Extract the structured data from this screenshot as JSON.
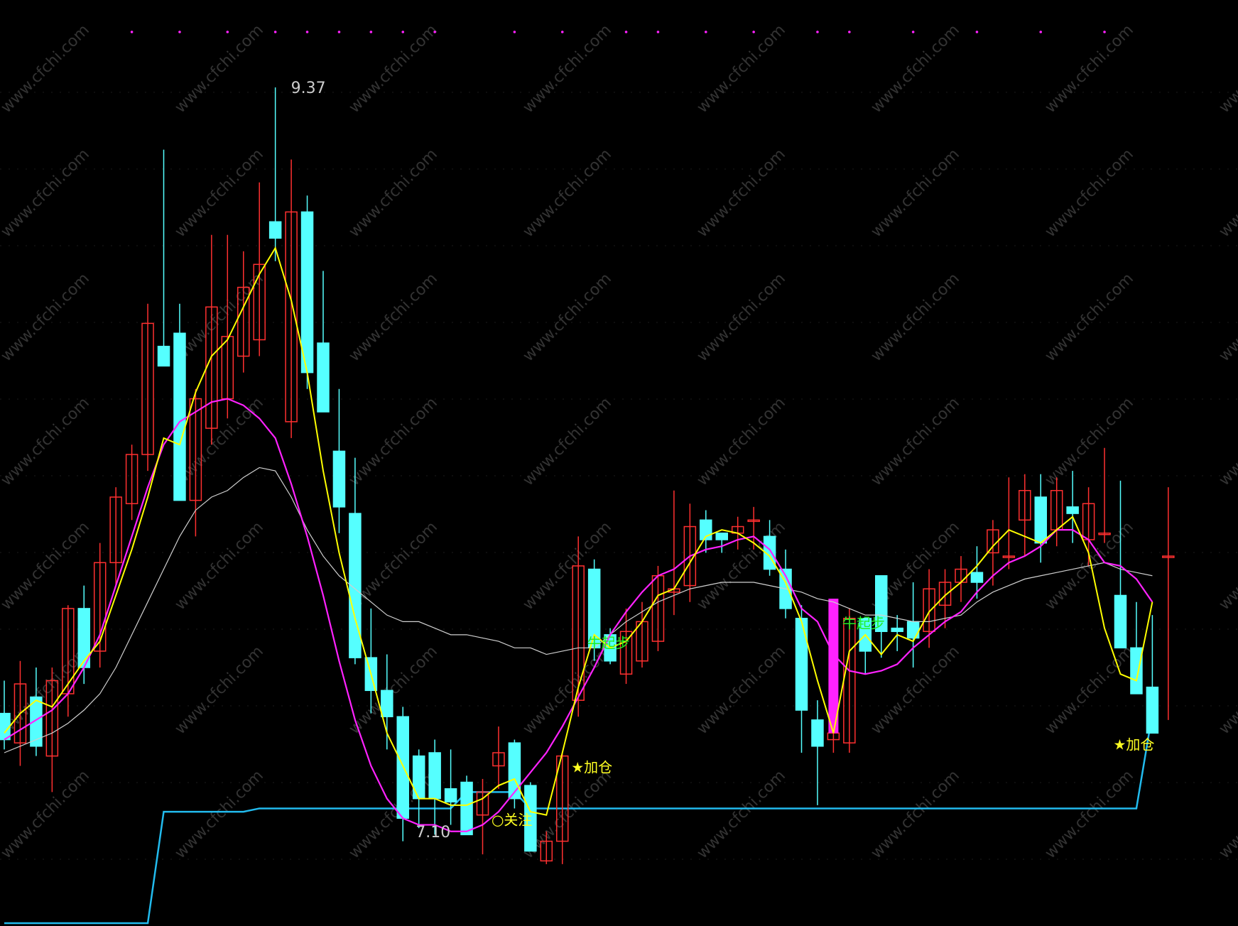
{
  "colors": {
    "background": "#000000",
    "up_candle": "#ff3030",
    "down_candle": "#55ffff",
    "ma_short": "#ffff00",
    "ma_mid": "#ff22ff",
    "ma_long": "#d0d0d0",
    "support": "#22bbee",
    "signal_green": "#22ee22",
    "signal_yellow": "#ffff22",
    "special_bar": "#ff22ff",
    "marker_dot": "#ff22ff",
    "watermark": "#333333"
  },
  "watermark": "www.cfchi.com",
  "chart_data": {
    "type": "candlestick",
    "ylim": [
      6.82,
      9.55
    ],
    "high_label": "9.37",
    "low_label": "7.10",
    "candles": [
      {
        "o": 7.46,
        "h": 7.56,
        "l": 7.35,
        "c": 7.38
      },
      {
        "o": 7.37,
        "h": 7.62,
        "l": 7.3,
        "c": 7.55
      },
      {
        "o": 7.51,
        "h": 7.6,
        "l": 7.33,
        "c": 7.36
      },
      {
        "o": 7.33,
        "h": 7.6,
        "l": 7.22,
        "c": 7.56
      },
      {
        "o": 7.52,
        "h": 7.79,
        "l": 7.45,
        "c": 7.78
      },
      {
        "o": 7.78,
        "h": 7.85,
        "l": 7.55,
        "c": 7.6
      },
      {
        "o": 7.65,
        "h": 7.98,
        "l": 7.6,
        "c": 7.92
      },
      {
        "o": 7.92,
        "h": 8.15,
        "l": 7.85,
        "c": 8.12
      },
      {
        "o": 8.1,
        "h": 8.28,
        "l": 8.05,
        "c": 8.25
      },
      {
        "o": 8.25,
        "h": 8.71,
        "l": 8.2,
        "c": 8.65
      },
      {
        "o": 8.58,
        "h": 9.18,
        "l": 8.52,
        "c": 8.52
      },
      {
        "o": 8.62,
        "h": 8.71,
        "l": 8.11,
        "c": 8.11
      },
      {
        "o": 8.11,
        "h": 8.45,
        "l": 8.0,
        "c": 8.42
      },
      {
        "o": 8.33,
        "h": 8.92,
        "l": 8.28,
        "c": 8.7
      },
      {
        "o": 8.42,
        "h": 8.92,
        "l": 8.36,
        "c": 8.61
      },
      {
        "o": 8.55,
        "h": 8.87,
        "l": 8.5,
        "c": 8.76
      },
      {
        "o": 8.6,
        "h": 9.08,
        "l": 8.55,
        "c": 8.83
      },
      {
        "o": 8.96,
        "h": 9.37,
        "l": 8.84,
        "c": 8.91
      },
      {
        "o": 8.35,
        "h": 9.15,
        "l": 8.3,
        "c": 8.99
      },
      {
        "o": 8.99,
        "h": 9.04,
        "l": 8.45,
        "c": 8.5
      },
      {
        "o": 8.59,
        "h": 8.81,
        "l": 8.38,
        "c": 8.38
      },
      {
        "o": 8.26,
        "h": 8.45,
        "l": 8.01,
        "c": 8.09
      },
      {
        "o": 8.07,
        "h": 8.24,
        "l": 7.61,
        "c": 7.63
      },
      {
        "o": 7.63,
        "h": 7.78,
        "l": 7.46,
        "c": 7.53
      },
      {
        "o": 7.53,
        "h": 7.64,
        "l": 7.35,
        "c": 7.45
      },
      {
        "o": 7.45,
        "h": 7.48,
        "l": 7.07,
        "c": 7.14
      },
      {
        "o": 7.33,
        "h": 7.35,
        "l": 7.11,
        "c": 7.2
      },
      {
        "o": 7.34,
        "h": 7.38,
        "l": 7.09,
        "c": 7.2
      },
      {
        "o": 7.23,
        "h": 7.35,
        "l": 7.12,
        "c": 7.19
      },
      {
        "o": 7.25,
        "h": 7.27,
        "l": 7.1,
        "c": 7.09
      },
      {
        "o": 7.15,
        "h": 7.26,
        "l": 7.03,
        "c": 7.22
      },
      {
        "o": 7.3,
        "h": 7.42,
        "l": 7.23,
        "c": 7.34
      },
      {
        "o": 7.37,
        "h": 7.38,
        "l": 7.17,
        "c": 7.2
      },
      {
        "o": 7.24,
        "h": 7.25,
        "l": 7.04,
        "c": 7.04
      },
      {
        "o": 7.01,
        "h": 7.1,
        "l": 7.0,
        "c": 7.07
      },
      {
        "o": 7.07,
        "h": 7.34,
        "l": 7.0,
        "c": 7.33
      },
      {
        "o": 7.5,
        "h": 8.0,
        "l": 7.45,
        "c": 7.91
      },
      {
        "o": 7.9,
        "h": 7.93,
        "l": 7.62,
        "c": 7.66
      },
      {
        "o": 7.7,
        "h": 7.72,
        "l": 7.61,
        "c": 7.62
      },
      {
        "o": 7.58,
        "h": 7.78,
        "l": 7.55,
        "c": 7.71
      },
      {
        "o": 7.62,
        "h": 7.8,
        "l": 7.6,
        "c": 7.74
      },
      {
        "o": 7.68,
        "h": 7.91,
        "l": 7.65,
        "c": 7.88
      },
      {
        "o": 7.83,
        "h": 8.14,
        "l": 7.76,
        "c": 7.84
      },
      {
        "o": 7.85,
        "h": 8.1,
        "l": 7.8,
        "c": 8.03
      },
      {
        "o": 8.05,
        "h": 8.08,
        "l": 7.95,
        "c": 7.99
      },
      {
        "o": 8.01,
        "h": 8.01,
        "l": 7.95,
        "c": 7.99
      },
      {
        "o": 8.01,
        "h": 8.06,
        "l": 7.96,
        "c": 8.03
      },
      {
        "o": 8.05,
        "h": 8.09,
        "l": 7.96,
        "c": 8.05
      },
      {
        "o": 8.0,
        "h": 8.05,
        "l": 7.88,
        "c": 7.9
      },
      {
        "o": 7.9,
        "h": 7.96,
        "l": 7.75,
        "c": 7.78
      },
      {
        "o": 7.75,
        "h": 7.79,
        "l": 7.34,
        "c": 7.47
      },
      {
        "o": 7.44,
        "h": 7.5,
        "l": 7.18,
        "c": 7.36
      },
      {
        "o": 7.38,
        "h": 7.48,
        "l": 7.34,
        "c": 7.4
      },
      {
        "o": 7.37,
        "h": 7.78,
        "l": 7.34,
        "c": 7.75
      },
      {
        "o": 7.75,
        "h": 7.75,
        "l": 7.58,
        "c": 7.65
      },
      {
        "o": 7.88,
        "h": 7.88,
        "l": 7.63,
        "c": 7.71
      },
      {
        "o": 7.72,
        "h": 7.76,
        "l": 7.65,
        "c": 7.71
      },
      {
        "o": 7.74,
        "h": 7.86,
        "l": 7.6,
        "c": 7.69
      },
      {
        "o": 7.71,
        "h": 7.9,
        "l": 7.66,
        "c": 7.84
      },
      {
        "o": 7.79,
        "h": 7.9,
        "l": 7.72,
        "c": 7.86
      },
      {
        "o": 7.86,
        "h": 7.94,
        "l": 7.8,
        "c": 7.9
      },
      {
        "o": 7.89,
        "h": 7.97,
        "l": 7.81,
        "c": 7.86
      },
      {
        "o": 7.95,
        "h": 8.05,
        "l": 7.85,
        "c": 8.02
      },
      {
        "o": 7.94,
        "h": 8.18,
        "l": 7.9,
        "c": 7.94
      },
      {
        "o": 8.05,
        "h": 8.19,
        "l": 7.94,
        "c": 8.14
      },
      {
        "o": 8.12,
        "h": 8.19,
        "l": 7.92,
        "c": 7.98
      },
      {
        "o": 8.02,
        "h": 8.18,
        "l": 7.97,
        "c": 8.14
      },
      {
        "o": 8.09,
        "h": 8.2,
        "l": 7.98,
        "c": 8.07
      },
      {
        "o": 7.99,
        "h": 8.15,
        "l": 7.91,
        "c": 8.1
      },
      {
        "o": 8.01,
        "h": 8.27,
        "l": 7.98,
        "c": 8.01
      },
      {
        "o": 7.82,
        "h": 8.17,
        "l": 7.74,
        "c": 7.66
      },
      {
        "o": 7.66,
        "h": 7.8,
        "l": 7.52,
        "c": 7.52
      },
      {
        "o": 7.54,
        "h": 7.76,
        "l": 7.4,
        "c": 7.4
      },
      {
        "o": 7.94,
        "h": 8.15,
        "l": 7.44,
        "c": 7.94
      }
    ],
    "ma_short": [
      7.4,
      7.46,
      7.5,
      7.48,
      7.55,
      7.62,
      7.68,
      7.82,
      7.96,
      8.12,
      8.3,
      8.28,
      8.44,
      8.55,
      8.6,
      8.7,
      8.8,
      8.88,
      8.72,
      8.5,
      8.2,
      7.95,
      7.75,
      7.58,
      7.4,
      7.3,
      7.2,
      7.2,
      7.18,
      7.18,
      7.2,
      7.24,
      7.26,
      7.16,
      7.15,
      7.34,
      7.54,
      7.7,
      7.66,
      7.68,
      7.74,
      7.82,
      7.84,
      7.92,
      8.0,
      8.02,
      8.01,
      7.98,
      7.94,
      7.86,
      7.74,
      7.56,
      7.4,
      7.65,
      7.7,
      7.64,
      7.7,
      7.68,
      7.77,
      7.82,
      7.86,
      7.91,
      7.97,
      8.02,
      8.0,
      7.98,
      8.02,
      8.06,
      7.95,
      7.72,
      7.58,
      7.56,
      7.8
    ],
    "ma_mid": [
      7.38,
      7.41,
      7.44,
      7.47,
      7.52,
      7.6,
      7.7,
      7.85,
      8.0,
      8.15,
      8.28,
      8.35,
      8.38,
      8.41,
      8.42,
      8.4,
      8.36,
      8.3,
      8.16,
      8.0,
      7.82,
      7.62,
      7.44,
      7.3,
      7.2,
      7.14,
      7.12,
      7.12,
      7.1,
      7.1,
      7.12,
      7.16,
      7.22,
      7.28,
      7.34,
      7.42,
      7.51,
      7.6,
      7.7,
      7.77,
      7.83,
      7.88,
      7.9,
      7.94,
      7.96,
      7.97,
      7.99,
      8.0,
      7.96,
      7.88,
      7.78,
      7.74,
      7.64,
      7.59,
      7.58,
      7.59,
      7.61,
      7.66,
      7.7,
      7.74,
      7.77,
      7.83,
      7.88,
      7.92,
      7.94,
      7.97,
      8.02,
      8.02,
      7.99,
      7.92,
      7.91,
      7.87,
      7.8
    ],
    "ma_long": [
      7.34,
      7.36,
      7.38,
      7.4,
      7.43,
      7.47,
      7.52,
      7.6,
      7.7,
      7.8,
      7.9,
      8.0,
      8.08,
      8.12,
      8.14,
      8.18,
      8.21,
      8.2,
      8.12,
      8.02,
      7.94,
      7.88,
      7.84,
      7.8,
      7.76,
      7.74,
      7.74,
      7.72,
      7.7,
      7.7,
      7.69,
      7.68,
      7.66,
      7.66,
      7.64,
      7.65,
      7.66,
      7.66,
      7.7,
      7.74,
      7.77,
      7.8,
      7.82,
      7.84,
      7.85,
      7.86,
      7.86,
      7.86,
      7.85,
      7.84,
      7.83,
      7.81,
      7.8,
      7.78,
      7.76,
      7.76,
      7.75,
      7.74,
      7.74,
      7.75,
      7.76,
      7.8,
      7.83,
      7.85,
      7.87,
      7.88,
      7.89,
      7.9,
      7.91,
      7.92,
      7.9,
      7.89,
      7.88
    ],
    "support": [
      6.82,
      6.82,
      6.82,
      6.82,
      6.82,
      6.82,
      6.82,
      6.82,
      6.82,
      6.82,
      7.16,
      7.16,
      7.16,
      7.16,
      7.16,
      7.16,
      7.17,
      7.17,
      7.17,
      7.17,
      7.17,
      7.17,
      7.17,
      7.17,
      7.17,
      7.17,
      7.17,
      7.17,
      7.17,
      7.22,
      7.22,
      7.22,
      7.22,
      7.17,
      7.17,
      7.17,
      7.17,
      7.17,
      7.17,
      7.17,
      7.17,
      7.17,
      7.17,
      7.17,
      7.17,
      7.17,
      7.17,
      7.17,
      7.17,
      7.17,
      7.17,
      7.17,
      7.17,
      7.17,
      7.17,
      7.17,
      7.17,
      7.17,
      7.17,
      7.17,
      7.17,
      7.17,
      7.17,
      7.17,
      7.17,
      7.17,
      7.17,
      7.17,
      7.17,
      7.17,
      7.17,
      7.17,
      7.46
    ],
    "special_bar": {
      "index": 52,
      "from": 7.4,
      "to": 7.81
    },
    "signals": [
      {
        "index": 37,
        "text": "牛起步",
        "price": 7.66,
        "color": "green"
      },
      {
        "index": 53,
        "text": "牛起步",
        "price": 7.72,
        "color": "green"
      },
      {
        "index": 36,
        "text": "★加仓",
        "price": 7.28,
        "color": "yellow"
      },
      {
        "index": 70,
        "text": "★加仓",
        "price": 7.35,
        "color": "yellow"
      },
      {
        "index": 31,
        "text": "○关注",
        "price": 7.12,
        "color": "yellow"
      }
    ],
    "top_dots": [
      8,
      11,
      14,
      17,
      19,
      21,
      23,
      25,
      27,
      32,
      35,
      39,
      41,
      44,
      47,
      51,
      53,
      57,
      61,
      65,
      69
    ]
  }
}
